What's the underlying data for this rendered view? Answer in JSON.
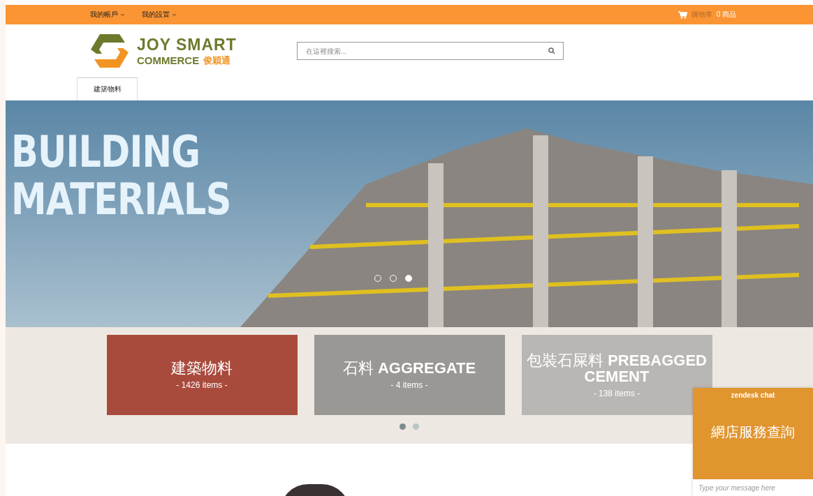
{
  "top_bar": {
    "menus": [
      {
        "label": "我的帳戶"
      },
      {
        "label": "我的設置"
      }
    ],
    "cart": {
      "label": "購物車",
      "count": "0 商品"
    }
  },
  "header": {
    "logo": {
      "line1": "JOY SMART",
      "line2": "COMMERCE",
      "chinese": "俊穎通"
    },
    "search": {
      "placeholder": "在這裡搜索..."
    }
  },
  "nav": {
    "tabs": [
      {
        "label": "建築物料",
        "selected": true
      }
    ]
  },
  "banner": {
    "title_lines": [
      "BUILDING",
      "MATERIALS"
    ],
    "dots": [
      {
        "selected": false
      },
      {
        "selected": false
      },
      {
        "selected": true
      }
    ]
  },
  "categories": {
    "items": [
      {
        "title": "建築物料",
        "count": "- 1426 items -",
        "color": "#a84a3c"
      },
      {
        "title": "石料 **AGGREGATE**",
        "count": "- 4 items -",
        "color": "#9a9894"
      },
      {
        "title": "包裝石屎料 **PREBAGGED CEMENT**",
        "count": "- 138 items -",
        "color": "#b9b7b3"
      }
    ],
    "dots": [
      {
        "selected": true
      },
      {
        "selected": false
      }
    ]
  },
  "chat": {
    "brand": "zendesk chat",
    "title": "網店服務查詢",
    "placeholder": "Type your message here"
  }
}
